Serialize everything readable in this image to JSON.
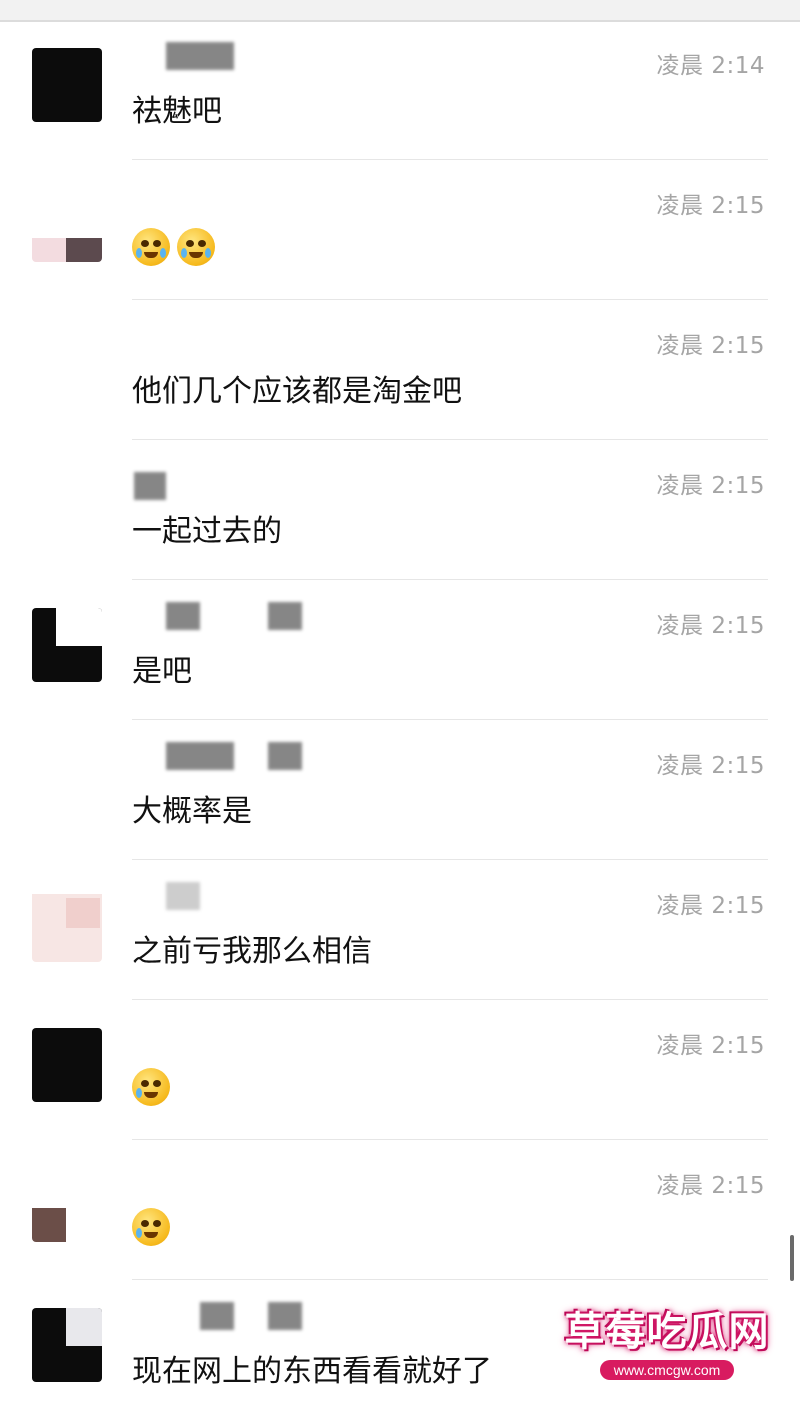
{
  "messages": [
    {
      "time": "凌晨 2:14",
      "text": "祛魅吧",
      "emoji": null
    },
    {
      "time": "凌晨 2:15",
      "text": "",
      "emoji": "crying-face-emoji x2"
    },
    {
      "time": "凌晨 2:15",
      "text": "他们几个应该都是淘金吧",
      "emoji": null
    },
    {
      "time": "凌晨 2:15",
      "text": "一起过去的",
      "emoji": null
    },
    {
      "time": "凌晨 2:15",
      "text": "是吧",
      "emoji": null
    },
    {
      "time": "凌晨 2:15",
      "text": "大概率是",
      "emoji": null
    },
    {
      "time": "凌晨 2:15",
      "text": "之前亏我那么相信",
      "emoji": null
    },
    {
      "time": "凌晨 2:15",
      "text": "",
      "emoji": "facepalm-laugh-emoji"
    },
    {
      "time": "凌晨 2:15",
      "text": "",
      "emoji": "facepalm-laugh-emoji"
    },
    {
      "time": "",
      "text": "现在网上的东西看看就好了",
      "emoji": null
    }
  ],
  "watermark": {
    "title": "草莓吃瓜网",
    "url": "www.cmcgw.com"
  },
  "colors": {
    "time": "#a5a5a5",
    "text": "#111111",
    "divider": "#e6e6e6",
    "watermark_accent": "#d81b60"
  }
}
